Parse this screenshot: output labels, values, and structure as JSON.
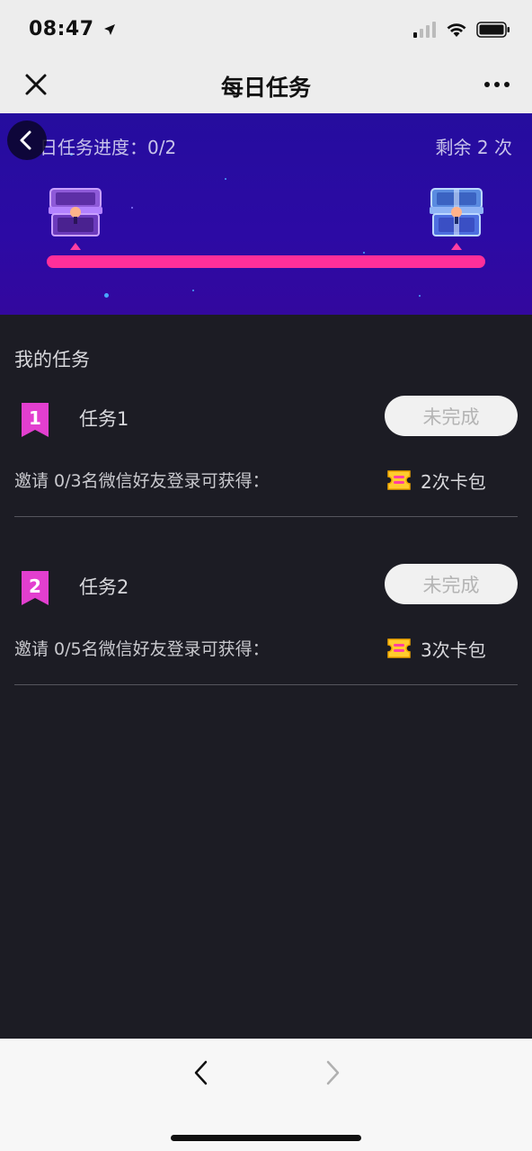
{
  "status_bar": {
    "time": "08:47",
    "icons": [
      "location-arrow-icon",
      "cellular-signal-icon",
      "wifi-icon",
      "battery-icon"
    ]
  },
  "nav": {
    "title": "每日任务",
    "close_icon": "close-icon",
    "more_icon": "more-dots-icon"
  },
  "hero": {
    "progress_label": "日任务进度：0/2",
    "remaining": "剩余 2 次",
    "back_icon": "chevron-left-icon",
    "chests": [
      "treasure-chest-purple-icon",
      "treasure-chest-blue-icon"
    ],
    "colors": {
      "background": "#2a0ba2",
      "bar": "#ff2f9a"
    }
  },
  "tasks_section": {
    "title": "我的任务",
    "tasks": [
      {
        "name": "任务1",
        "status": "未完成",
        "description": "邀请 0/3名微信好友登录可获得：",
        "reward": "2次卡包",
        "badge_number": "1"
      },
      {
        "name": "任务2",
        "status": "未完成",
        "description": "邀请 0/5名微信好友登录可获得：",
        "reward": "3次卡包",
        "badge_number": "2"
      }
    ]
  },
  "bottom_bar": {
    "back_icon": "chevron-left-icon",
    "forward_icon": "chevron-right-icon"
  }
}
